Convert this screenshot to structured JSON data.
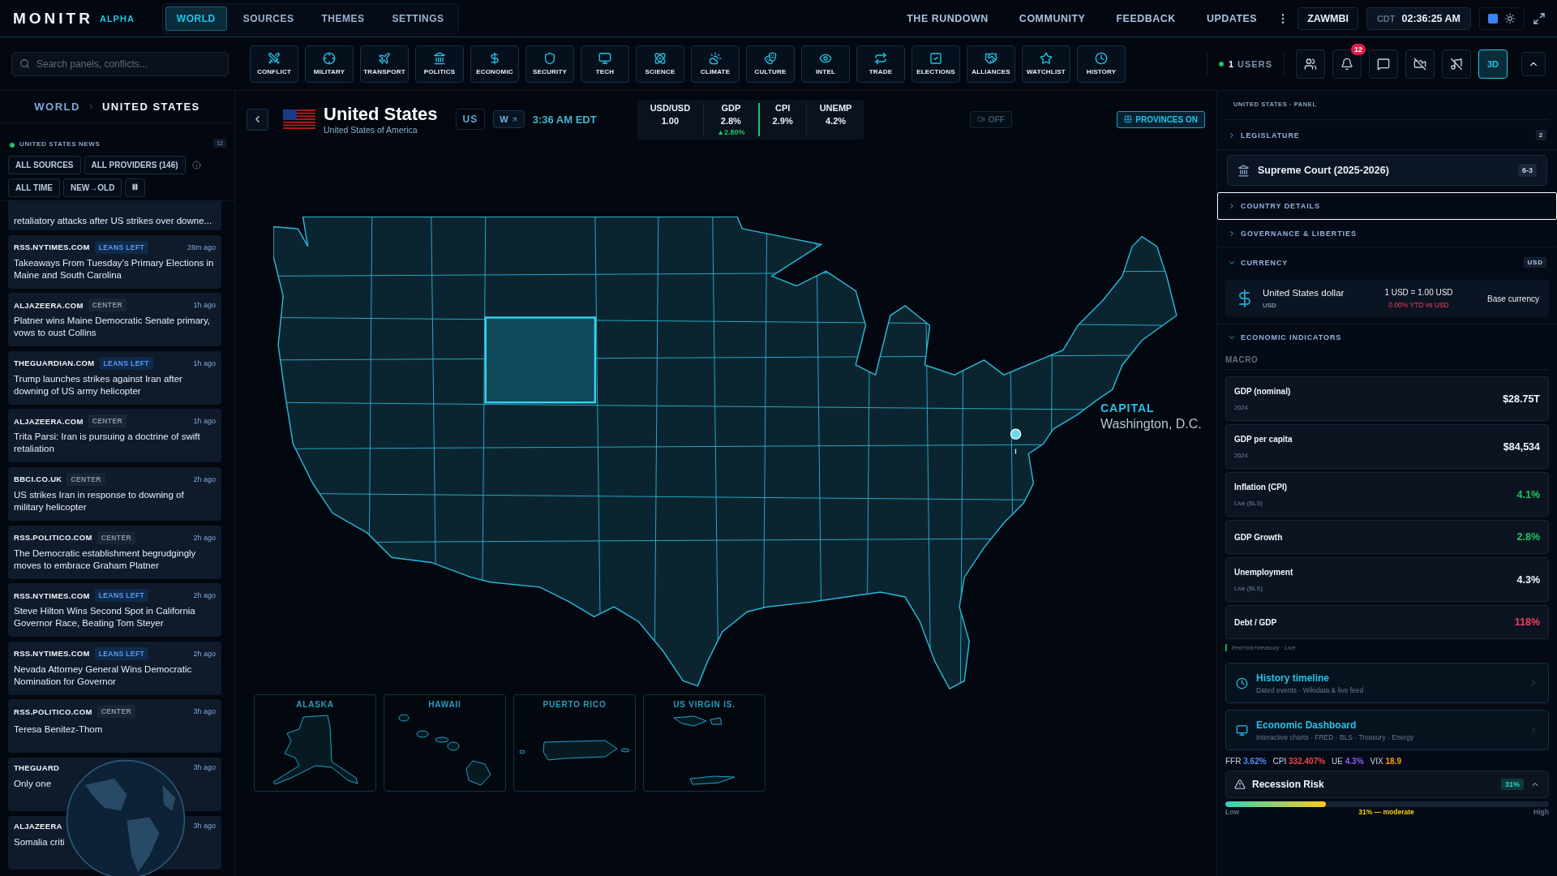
{
  "brand": {
    "name": "MONITR",
    "tag": "ALPHA"
  },
  "nav": [
    {
      "label": "WORLD",
      "selected": true
    },
    {
      "label": "SOURCES",
      "selected": false
    },
    {
      "label": "THEMES",
      "selected": false
    },
    {
      "label": "SETTINGS",
      "selected": false
    }
  ],
  "top_links": [
    "THE RUNDOWN",
    "COMMUNITY",
    "FEEDBACK",
    "UPDATES"
  ],
  "user": "ZAWMBI",
  "clock": {
    "zone": "CDT",
    "time": "02:36:25 AM"
  },
  "search": {
    "placeholder": "Search panels, conflicts..."
  },
  "categories": [
    "CONFLICT",
    "MILITARY",
    "TRANSPORT",
    "POLITICS",
    "ECONOMIC",
    "SECURITY",
    "TECH",
    "SCIENCE",
    "CLIMATE",
    "CULTURE",
    "INTEL",
    "TRADE",
    "ELECTIONS",
    "ALLIANCES",
    "WATCHLIST",
    "HISTORY"
  ],
  "users": {
    "count": "1",
    "label": "USERS",
    "online": true
  },
  "notifications": "12",
  "view_3d": {
    "label": "3D",
    "on": true
  },
  "breadcrumb": [
    "WORLD",
    "UNITED STATES"
  ],
  "news": {
    "title": "UNITED STATES NEWS",
    "count": "12",
    "sources": "ALL SOURCES",
    "providers": "ALL PROVIDERS (146)",
    "period": "ALL TIME",
    "order": "NEW→OLD",
    "partial": "retaliatory attacks after US strikes over downe...",
    "items": [
      {
        "source": "RSS.NYTIMES.COM",
        "bias": "LEANS LEFT",
        "kind": "left",
        "time": "28m ago",
        "headline": "Takeaways From Tuesday’s Primary Elections in Maine and South Carolina"
      },
      {
        "source": "ALJAZEERA.COM",
        "bias": "CENTER",
        "kind": "center",
        "time": "1h ago",
        "headline": "Platner wins Maine Democratic Senate primary, vows to oust Collins"
      },
      {
        "source": "THEGUARDIAN.COM",
        "bias": "LEANS LEFT",
        "kind": "left",
        "time": "1h ago",
        "headline": "Trump launches strikes against Iran after downing of US army helicopter"
      },
      {
        "source": "ALJAZEERA.COM",
        "bias": "CENTER",
        "kind": "center",
        "time": "1h ago",
        "headline": "Trita Parsi: Iran is pursuing a doctrine of swift retaliation"
      },
      {
        "source": "BBCI.CO.UK",
        "bias": "CENTER",
        "kind": "center",
        "time": "2h ago",
        "headline": "US strikes Iran in response to downing of military helicopter"
      },
      {
        "source": "RSS.POLITICO.COM",
        "bias": "CENTER",
        "kind": "center",
        "time": "2h ago",
        "headline": "The Democratic establishment begrudgingly moves to embrace Graham Platner"
      },
      {
        "source": "RSS.NYTIMES.COM",
        "bias": "LEANS LEFT",
        "kind": "left",
        "time": "2h ago",
        "headline": "Steve Hilton Wins Second Spot in California Governor Race, Beating Tom Steyer"
      },
      {
        "source": "RSS.NYTIMES.COM",
        "bias": "LEANS LEFT",
        "kind": "left",
        "time": "2h ago",
        "headline": "Nevada Attorney General Wins Democratic Nomination for Governor"
      },
      {
        "source": "RSS.POLITICO.COM",
        "bias": "CENTER",
        "kind": "center",
        "time": "3h ago",
        "headline": "Teresa Benitez-Thom"
      },
      {
        "source": "THEGUARD",
        "kind": "none",
        "time": "3h ago",
        "headline": "Only one"
      },
      {
        "source": "ALJAZEERA",
        "kind": "none",
        "time": "3h ago",
        "headline": "Somalia criti"
      }
    ]
  },
  "country": {
    "name": "United States",
    "full_name": "United States of America",
    "code": "US",
    "weather": "W",
    "local_time": "3:36 AM EDT",
    "stats": [
      {
        "label": "USD/USD",
        "value": "1.00"
      },
      {
        "label": "GDP",
        "value": "2.8%",
        "change": "▲2.80%"
      },
      {
        "label": "CPI",
        "value": "2.9%"
      },
      {
        "label": "UNEMP",
        "value": "4.2%"
      }
    ],
    "camera": {
      "label": "OFF",
      "on": false
    },
    "provinces": {
      "label": "PROVINCES ON",
      "on": true
    }
  },
  "map": {
    "capital_label": "CAPITAL",
    "capital_name": "Washington, D.C.",
    "insets": [
      {
        "label": "ALASKA",
        "kind": "alaska"
      },
      {
        "label": "HAWAII",
        "kind": "hawaii"
      },
      {
        "label": "PUERTO RICO",
        "kind": "puertorico"
      },
      {
        "label": "US VIRGIN IS.",
        "kind": "vi"
      }
    ]
  },
  "panel": {
    "title": "UNITED STATES · PANEL",
    "legislature": {
      "title": "LEGISLATURE",
      "expanded": false,
      "badge": "2"
    },
    "court": {
      "label": "Supreme Court (2025-2026)",
      "split": "6-3"
    },
    "country_details": {
      "title": "COUNTRY DETAILS",
      "expanded": false,
      "focused": true
    },
    "governance": {
      "title": "GOVERNANCE & LIBERTIES",
      "expanded": false
    },
    "currency": {
      "title": "CURRENCY",
      "expanded": true,
      "badge": "USD",
      "name": "United States dollar",
      "code": "USD",
      "rate": "1 USD = 1.00 USD",
      "ytd": "0.00% YTD vs USD",
      "note": "Base currency"
    },
    "economy": {
      "title": "ECONOMIC INDICATORS",
      "expanded": true,
      "group": "MACRO",
      "source": "fred+bls+treasury · Live",
      "rows": [
        {
          "label": "GDP (nominal)",
          "sub": "2024",
          "value": "$28.75T",
          "color": "#f2f5f9"
        },
        {
          "label": "GDP per capita",
          "sub": "2024",
          "value": "$84,534",
          "color": "#f2f5f9"
        },
        {
          "label": "Inflation (CPI)",
          "sub": "Live (BLS)",
          "value": "4.1%",
          "color": "#22c55e"
        },
        {
          "label": "GDP Growth",
          "value": "2.8%",
          "color": "#22c55e"
        },
        {
          "label": "Unemployment",
          "sub": "Live (BLS)",
          "value": "4.3%",
          "color": "#f2f5f9"
        },
        {
          "label": "Debt / GDP",
          "value": "118%",
          "color": "#f43f5e"
        }
      ]
    },
    "links": [
      {
        "title": "History timeline",
        "subtitle": "Dated events · Wikidata & live feed",
        "kind": "clock"
      },
      {
        "title": "Economic Dashboard",
        "subtitle": "Interactive charts · FRED · BLS · Treasury · Energy",
        "kind": "monitor"
      }
    ],
    "ticker": [
      {
        "label": "FFR",
        "value": "3.62%",
        "color": "#4f8ef7"
      },
      {
        "label": "CPI",
        "value": "332.407%",
        "color": "#ef4444"
      },
      {
        "label": "UE",
        "value": "4.3%",
        "color": "#8b5cf6"
      },
      {
        "label": "VIX",
        "value": "18.9",
        "color": "#f59e0b"
      }
    ],
    "recession": {
      "title": "Recession Risk",
      "value": "31%",
      "level": 0.31,
      "expanded": true,
      "low": "Low",
      "reading": "31% — moderate",
      "high": "High"
    }
  }
}
